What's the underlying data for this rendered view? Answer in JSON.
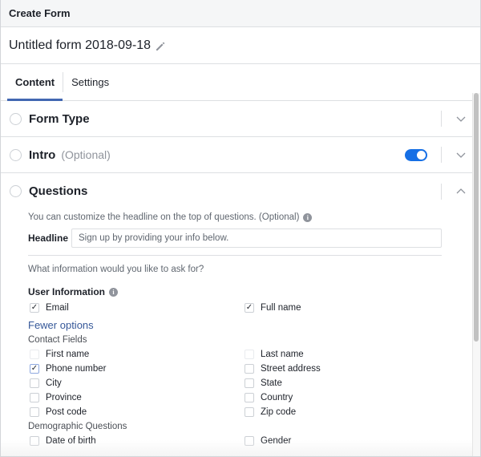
{
  "window": {
    "title": "Create Form"
  },
  "form": {
    "name": "Untitled form 2018-09-18",
    "edit_icon": "pencil-icon"
  },
  "tabs": [
    {
      "label": "Content",
      "active": true
    },
    {
      "label": "Settings",
      "active": false
    }
  ],
  "sections": {
    "form_type": {
      "title": "Form Type",
      "expanded": false
    },
    "intro": {
      "title": "Intro",
      "optional_label": "(Optional)",
      "toggle_on": true,
      "expanded": false
    },
    "questions": {
      "title": "Questions",
      "expanded": true
    }
  },
  "questions": {
    "headline_hint": "You can customize the headline on the top of questions. (Optional)",
    "headline_label": "Headline",
    "headline_placeholder": "Sign up by providing your info below.",
    "ask_prompt": "What information would you like to ask for?",
    "user_info_title": "User Information",
    "user_info": [
      {
        "label": "Email",
        "checked": true
      },
      {
        "label": "Full name",
        "checked": true
      }
    ],
    "fewer_options_link": "Fewer options",
    "contact_fields_title": "Contact Fields",
    "contact_fields": [
      {
        "label": "First name",
        "checked": false
      },
      {
        "label": "Last name",
        "checked": false
      },
      {
        "label": "Phone number",
        "checked": true
      },
      {
        "label": "Street address",
        "checked": false
      },
      {
        "label": "City",
        "checked": false
      },
      {
        "label": "State",
        "checked": false
      },
      {
        "label": "Province",
        "checked": false
      },
      {
        "label": "Country",
        "checked": false
      },
      {
        "label": "Post code",
        "checked": false
      },
      {
        "label": "Zip code",
        "checked": false
      }
    ],
    "demographic_title": "Demographic Questions",
    "demographic": [
      {
        "label": "Date of birth",
        "checked": false
      },
      {
        "label": "Gender",
        "checked": false
      }
    ]
  },
  "colors": {
    "accent": "#4267b2",
    "toggle": "#166fe5",
    "link": "#365899"
  }
}
